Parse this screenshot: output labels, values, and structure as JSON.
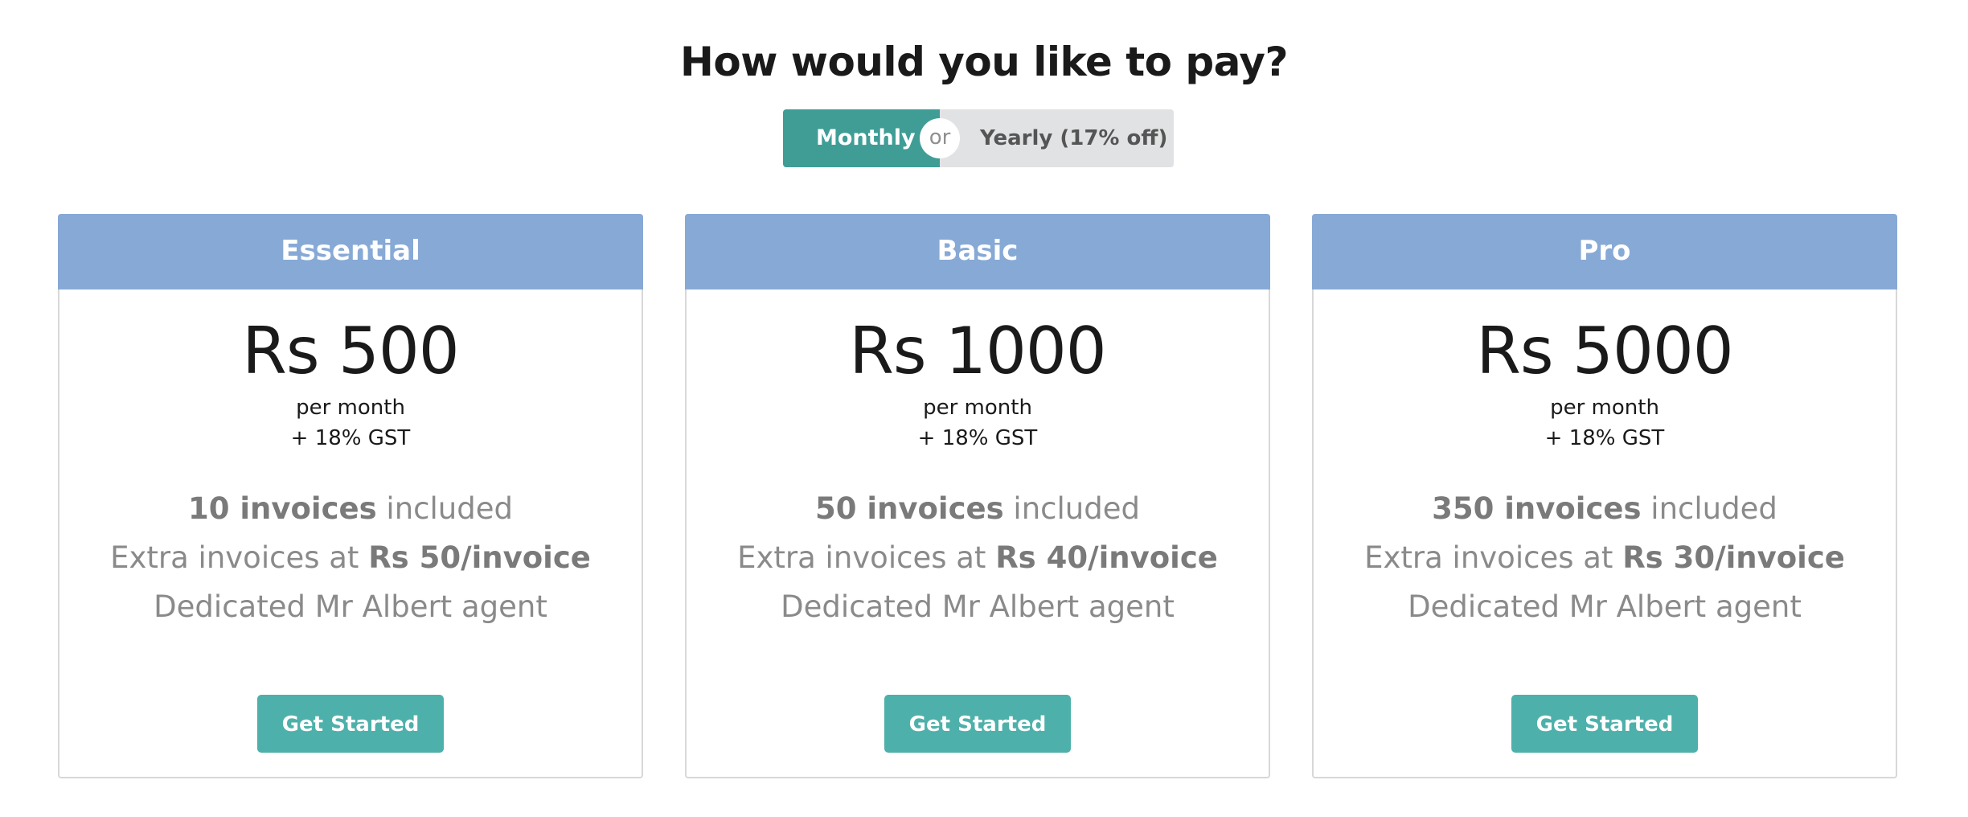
{
  "header": {
    "title": "How would you like to pay?"
  },
  "billing_toggle": {
    "monthly_label": "Monthly",
    "separator": "or",
    "yearly_label": "Yearly (17% off)",
    "selected": "Monthly"
  },
  "plans": [
    {
      "name": "Essential",
      "price": "Rs 500",
      "period": "per month",
      "tax": "+ 18% GST",
      "included_count": "10 invoices",
      "included_suffix": " included",
      "extra_prefix": "Extra invoices at ",
      "extra_rate": "Rs 50/invoice",
      "agent": "Dedicated Mr Albert agent",
      "cta": "Get Started"
    },
    {
      "name": "Basic",
      "price": "Rs 1000",
      "period": "per month",
      "tax": "+ 18% GST",
      "included_count": "50 invoices",
      "included_suffix": " included",
      "extra_prefix": "Extra invoices at ",
      "extra_rate": "Rs 40/invoice",
      "agent": "Dedicated Mr Albert agent",
      "cta": "Get Started"
    },
    {
      "name": "Pro",
      "price": "Rs 5000",
      "period": "per month",
      "tax": "+ 18% GST",
      "included_count": "350 invoices",
      "included_suffix": " included",
      "extra_prefix": "Extra invoices at ",
      "extra_rate": "Rs 30/invoice",
      "agent": "Dedicated Mr Albert agent",
      "cta": "Get Started"
    }
  ],
  "colors": {
    "toggle_active": "#3f9d96",
    "toggle_inactive": "#e1e2e4",
    "card_header": "#87a9d6",
    "cta_button": "#4eb0aa",
    "feature_text": "#8a8a8a"
  }
}
